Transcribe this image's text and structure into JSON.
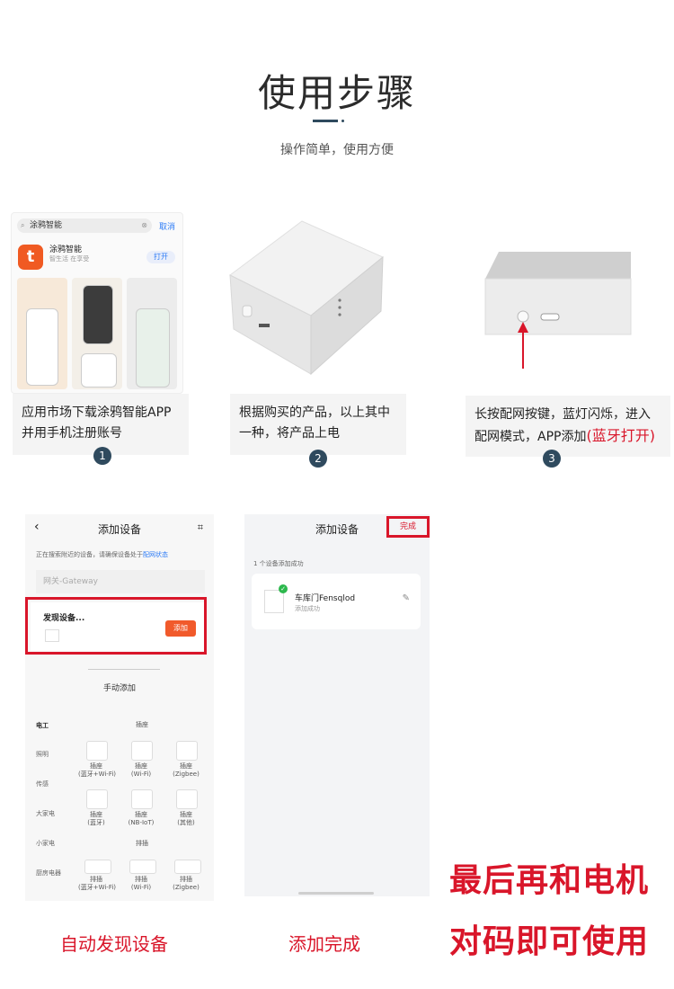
{
  "header": {
    "title": "使用步骤",
    "subtitle": "操作简单，使用方便"
  },
  "steps": [
    {
      "number": "1",
      "caption": "应用市场下载涂鸦智能APP并用手机注册账号"
    },
    {
      "number": "2",
      "caption": "根据购买的产品，以上其中一种，将产品上电"
    },
    {
      "number": "3",
      "caption_main": "长按配网按键，蓝灯闪烁，进入配网模式，APP添加",
      "caption_highlight": "(蓝牙打开)"
    }
  ],
  "app_store": {
    "search_text": "涂鸦智能",
    "cancel_label": "取消",
    "app_name": "涂鸦智能",
    "app_subtitle": "智生活 在享受",
    "open_label": "打开",
    "icon": "tuya-logo-icon",
    "brand_color": "#f05a22"
  },
  "screen1": {
    "title": "添加设备",
    "back_icon": "back-arrow-icon",
    "scan_icon": "scan-icon",
    "hint_text": "正在搜索附近的设备，请确保设备处于",
    "hint_link": "配网状态",
    "gateway_placeholder": "网关-Gateway",
    "discover_label": "发现设备...",
    "add_button": "添加",
    "manual_title": "手动添加",
    "categories": [
      "电工",
      "照明",
      "传感",
      "大家电",
      "小家电",
      "厨房电器"
    ],
    "group1_title": "插座",
    "group1_items": [
      "插座\n(蓝牙+Wi-Fi)",
      "插座\n(Wi-Fi)",
      "插座\n(Zigbee)",
      "插座\n(蓝牙)",
      "插座\n(NB-IoT)",
      "插座\n(其他)"
    ],
    "group2_title": "排插",
    "group2_items": [
      "排插\n(蓝牙+Wi-Fi)",
      "排插\n(Wi-Fi)",
      "排插\n(Zigbee)"
    ]
  },
  "screen2": {
    "title": "添加设备",
    "done_label": "完成",
    "success_count": "1 个设备添加成功",
    "device_name": "车库门Fensqlod",
    "device_status": "添加成功",
    "edit_icon": "pencil-icon"
  },
  "labels": {
    "auto_discover": "自动发现设备",
    "add_done": "添加完成",
    "final_line1": "最后再和电机",
    "final_line2": "对码即可使用"
  },
  "colors": {
    "accent_red": "#d9162a",
    "step_badge": "#2f4a5e",
    "link_blue": "#2e7cf6"
  }
}
